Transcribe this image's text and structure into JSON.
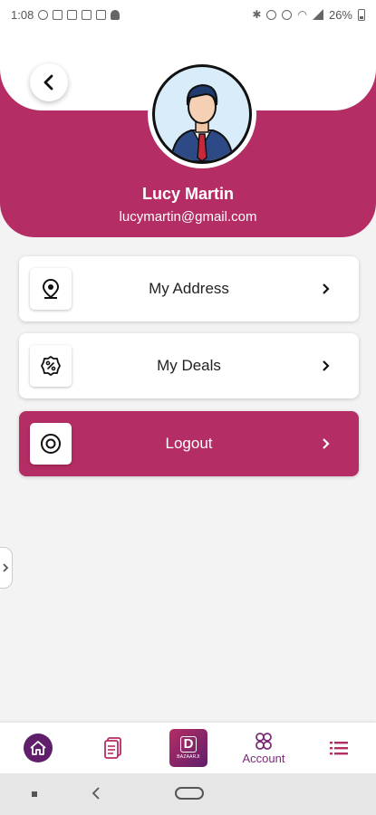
{
  "status_bar": {
    "time": "1:08",
    "battery": "26%"
  },
  "profile": {
    "name": "Lucy Martin",
    "email": "lucymartin@gmail.com"
  },
  "menu": [
    {
      "label": "My Address",
      "icon": "location-pin-icon"
    },
    {
      "label": "My Deals",
      "icon": "discount-badge-icon"
    },
    {
      "label": "Logout",
      "icon": "logout-target-icon",
      "active": true
    }
  ],
  "bottom_nav": {
    "account_label": "Account",
    "logo_text": "BAZAARJI"
  },
  "colors": {
    "brand_pink": "#b42d64",
    "brand_purple": "#5f1f6b",
    "background": "#f3f3f3"
  }
}
